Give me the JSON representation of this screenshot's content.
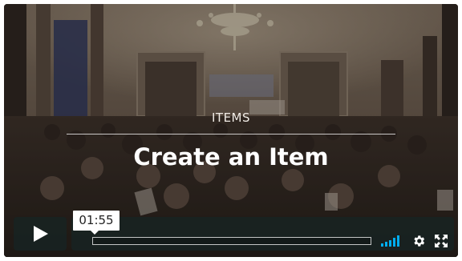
{
  "video": {
    "section_label": "ITEMS",
    "title": "Create an Item"
  },
  "player": {
    "timecode": "01:55",
    "progress_percent": 0,
    "accent_color": "#00adef",
    "controls": {
      "play_icon": "play-icon",
      "volume_icon": "volume-bars-icon",
      "settings_icon": "gear-icon",
      "fullscreen_icon": "fullscreen-icon"
    }
  }
}
